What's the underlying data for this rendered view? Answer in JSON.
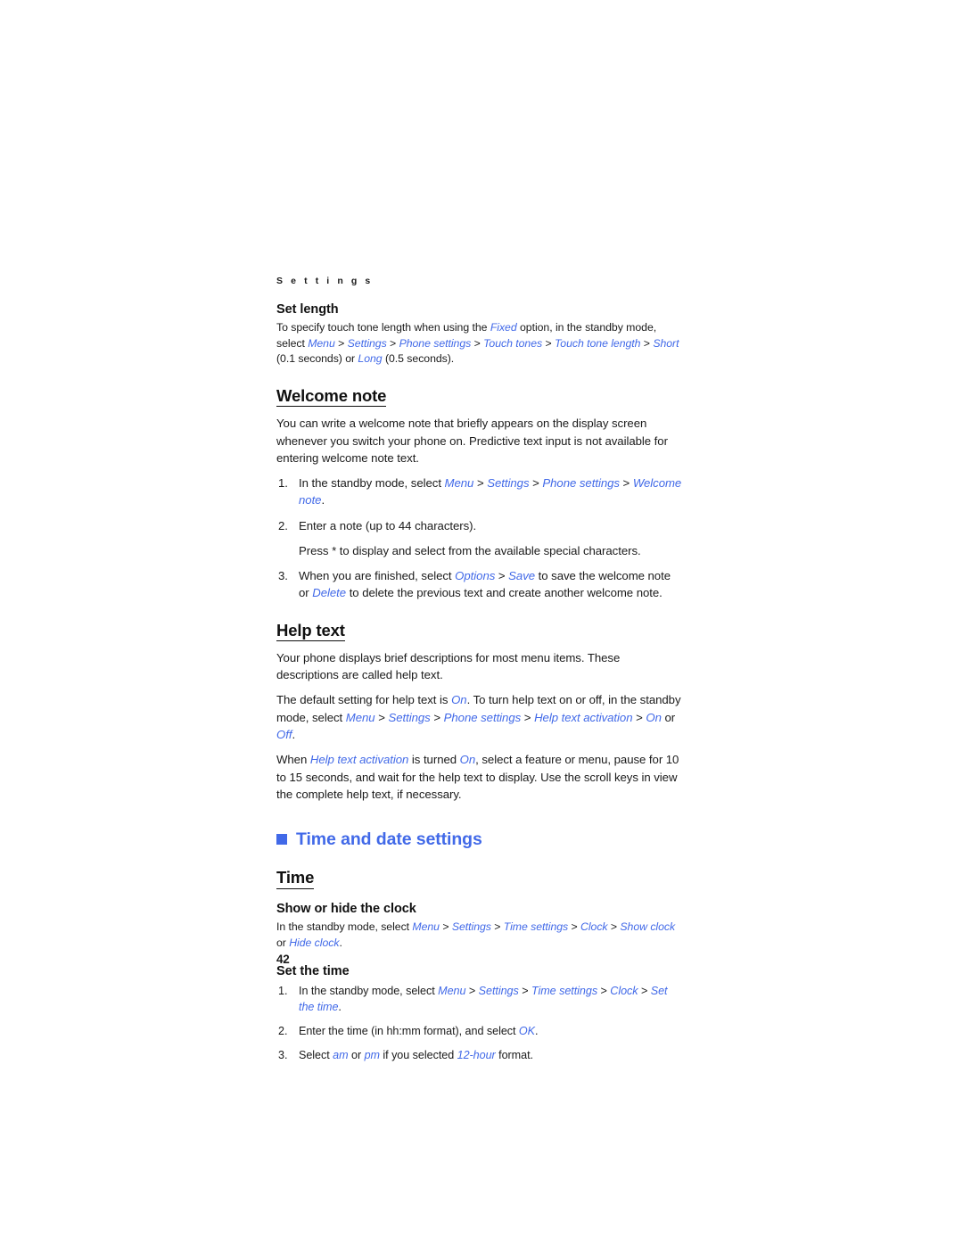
{
  "document": {
    "running_header": "S e t t i n g s",
    "page_number": "42"
  },
  "sections": [
    {
      "id": "set-length",
      "heading": "Set length",
      "body": {
        "t1": "To specify touch tone length when using the ",
        "l1": "Fixed",
        "t2": " option, in the standby mode, select ",
        "l2": "Menu",
        "s1": " > ",
        "l3": "Settings",
        "s2": " > ",
        "l4": "Phone settings",
        "s3": " > ",
        "l5": "Touch tones",
        "s4": " > ",
        "l6": "Touch tone length",
        "s5": " > ",
        "l7": "Short",
        "t3": " (0.1 seconds) or ",
        "l8": "Long",
        "t4": " (0.5 seconds)."
      }
    },
    {
      "id": "welcome-note",
      "heading": "Welcome note",
      "intro": "You can write a welcome note that briefly appears on the display screen whenever you switch your phone on. Predictive text input is not available for entering welcome note text.",
      "steps": [
        {
          "num": "1.",
          "t1": "In the standby mode, select ",
          "l1": "Menu",
          "s1": " > ",
          "l2": "Settings",
          "s2": " > ",
          "l3": "Phone settings",
          "s3": " > ",
          "l4": "Welcome note",
          "t2": "."
        },
        {
          "num": "2.",
          "t1": "Enter a note (up to 44 characters).",
          "sub": "Press * to display and select from the available special characters."
        },
        {
          "num": "3.",
          "t1": "When you are finished, select ",
          "l1": "Options",
          "s1": " > ",
          "l2": "Save",
          "t2": " to save the welcome note or ",
          "l3": "Delete",
          "t3": " to delete the previous text and create another welcome note."
        }
      ]
    },
    {
      "id": "help-text",
      "heading": "Help text",
      "p1": "Your phone displays brief descriptions for most menu items. These descriptions are called help text.",
      "p2": {
        "t1": "The default setting for help text is ",
        "l1": "On",
        "t2": ". To turn help text on or off, in the standby mode, select ",
        "l2": "Menu",
        "s1": " > ",
        "l3": "Settings",
        "s2": " > ",
        "l4": "Phone settings",
        "s3": " > ",
        "l5": "Help text activation",
        "s4": " > ",
        "l6": "On",
        "t3": " or ",
        "l7": "Off",
        "t4": "."
      },
      "p3": {
        "t1": "When ",
        "l1": "Help text activation",
        "t2": " is turned ",
        "l2": "On",
        "t3": ", select a feature or menu, pause for 10 to 15 seconds, and wait for the help text to display. Use the scroll keys in view the complete help text, if necessary."
      }
    }
  ],
  "time_and_date": {
    "heading": "Time and date settings",
    "bullet_icon": "square-bullet",
    "accent_color": "#4169e8",
    "sub_heading": "Time",
    "show_hide_clock": {
      "heading": "Show or hide the clock",
      "body": {
        "t1": "In the standby mode, select ",
        "l1": "Menu",
        "s1": " > ",
        "l2": "Settings",
        "s2": " > ",
        "l3": "Time settings",
        "s3": " > ",
        "l4": "Clock",
        "s4": " > ",
        "l5": "Show clock",
        "t2": " or ",
        "l6": "Hide clock",
        "t3": "."
      }
    },
    "set_the_time": {
      "heading": "Set the time",
      "steps": [
        {
          "num": "1.",
          "t1": "In the standby mode, select ",
          "l1": "Menu",
          "s1": " > ",
          "l2": "Settings",
          "s2": " > ",
          "l3": "Time settings",
          "s3": " > ",
          "l4": "Clock",
          "s4": " > ",
          "l5": "Set the time",
          "t2": "."
        },
        {
          "num": "2.",
          "t1": "Enter the time (in hh:mm format), and select ",
          "l1": "OK",
          "t2": "."
        },
        {
          "num": "3.",
          "t1": "Select ",
          "l1": "am",
          "t2": " or ",
          "l2": "pm",
          "t3": " if you selected ",
          "l3": "12-hour",
          "t4": " format."
        }
      ]
    }
  }
}
